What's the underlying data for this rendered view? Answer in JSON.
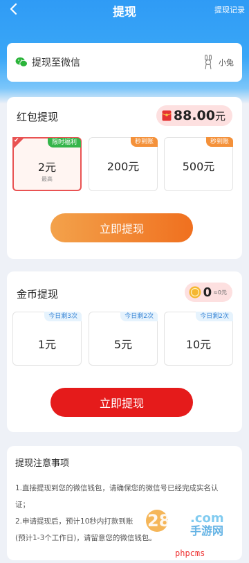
{
  "header": {
    "title": "提现",
    "record_link": "提现记录"
  },
  "wechat": {
    "label": "提现至微信",
    "user_name": "小兔"
  },
  "red_packet": {
    "title": "红包提现",
    "balance": "88.00",
    "balance_unit": "元",
    "options": [
      {
        "amount": "2元",
        "tag": "限时福利",
        "sub": "最高",
        "selected": true
      },
      {
        "amount": "200元",
        "tag": "秒到账"
      },
      {
        "amount": "500元",
        "tag": "秒到账"
      }
    ],
    "button": "立即提现"
  },
  "gold": {
    "title": "金币提现",
    "coins": "0",
    "coins_equiv": "≈0元",
    "options": [
      {
        "amount": "1元",
        "tag": "今日剩3次"
      },
      {
        "amount": "5元",
        "tag": "今日剩2次"
      },
      {
        "amount": "10元",
        "tag": "今日剩2次"
      }
    ],
    "button": "立即提现"
  },
  "notes": {
    "title": "提现注意事项",
    "lines": [
      "1.直接提现到您的微信钱包，请确保您的微信号已经完成实名认",
      "证；",
      "2.申请提现后，预计10秒内打款到账",
      "(预计1-3个工作日)，请留意您的微信钱包。"
    ]
  },
  "watermark": {
    "text": "phpcms"
  },
  "colors": {
    "header_blue": "#2f9bf5",
    "button_orange": "#f0701f",
    "button_red": "#e51b1b",
    "selected_border": "#e95252",
    "tag_green": "#35b54a",
    "tag_orange": "#f4913a"
  }
}
